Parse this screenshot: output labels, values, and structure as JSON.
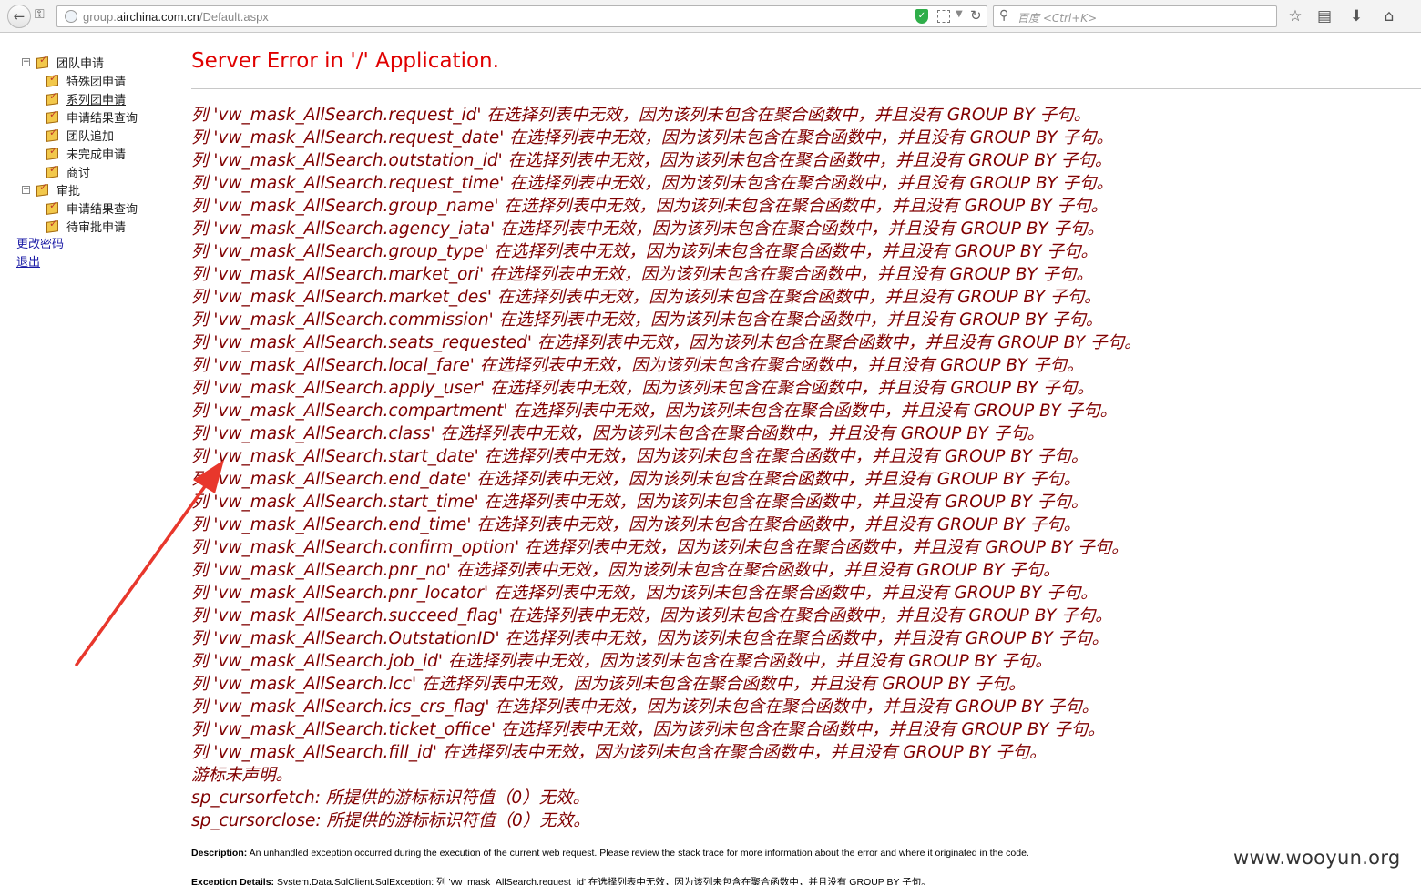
{
  "browser": {
    "url_prefix": "group.",
    "url_host": "airchina.com.cn",
    "url_path": "/Default.aspx",
    "search_placeholder": "百度 <Ctrl+K>"
  },
  "sidebar": {
    "groups": [
      {
        "label": "团队申请",
        "expander": "−",
        "items": [
          "特殊团申请",
          "系列团申请",
          "申请结果查询",
          "团队追加",
          "未完成申请",
          "商讨"
        ]
      },
      {
        "label": "审批",
        "expander": "−",
        "items": [
          "申请结果查询",
          "待审批申请"
        ]
      }
    ],
    "links": [
      "更改密码",
      "退出"
    ]
  },
  "error": {
    "title": "Server Error in '/' Application.",
    "lines": [
      "列 'vw_mask_AllSearch.request_id' 在选择列表中无效，因为该列未包含在聚合函数中，并且没有 GROUP BY 子句。",
      "列 'vw_mask_AllSearch.request_date' 在选择列表中无效，因为该列未包含在聚合函数中，并且没有 GROUP BY 子句。",
      "列 'vw_mask_AllSearch.outstation_id' 在选择列表中无效，因为该列未包含在聚合函数中，并且没有 GROUP BY 子句。",
      "列 'vw_mask_AllSearch.request_time' 在选择列表中无效，因为该列未包含在聚合函数中，并且没有 GROUP BY 子句。",
      "列 'vw_mask_AllSearch.group_name' 在选择列表中无效，因为该列未包含在聚合函数中，并且没有 GROUP BY 子句。",
      "列 'vw_mask_AllSearch.agency_iata' 在选择列表中无效，因为该列未包含在聚合函数中，并且没有 GROUP BY 子句。",
      "列 'vw_mask_AllSearch.group_type' 在选择列表中无效，因为该列未包含在聚合函数中，并且没有 GROUP BY 子句。",
      "列 'vw_mask_AllSearch.market_ori' 在选择列表中无效，因为该列未包含在聚合函数中，并且没有 GROUP BY 子句。",
      "列 'vw_mask_AllSearch.market_des' 在选择列表中无效，因为该列未包含在聚合函数中，并且没有 GROUP BY 子句。",
      "列 'vw_mask_AllSearch.commission' 在选择列表中无效，因为该列未包含在聚合函数中，并且没有 GROUP BY 子句。",
      "列 'vw_mask_AllSearch.seats_requested' 在选择列表中无效，因为该列未包含在聚合函数中，并且没有 GROUP BY 子句。",
      "列 'vw_mask_AllSearch.local_fare' 在选择列表中无效，因为该列未包含在聚合函数中，并且没有 GROUP BY 子句。",
      "列 'vw_mask_AllSearch.apply_user' 在选择列表中无效，因为该列未包含在聚合函数中，并且没有 GROUP BY 子句。",
      "列 'vw_mask_AllSearch.compartment' 在选择列表中无效，因为该列未包含在聚合函数中，并且没有 GROUP BY 子句。",
      "列 'vw_mask_AllSearch.class' 在选择列表中无效，因为该列未包含在聚合函数中，并且没有 GROUP BY 子句。",
      "列 'vw_mask_AllSearch.start_date' 在选择列表中无效，因为该列未包含在聚合函数中，并且没有 GROUP BY 子句。",
      "列 'vw_mask_AllSearch.end_date' 在选择列表中无效，因为该列未包含在聚合函数中，并且没有 GROUP BY 子句。",
      "列 'vw_mask_AllSearch.start_time' 在选择列表中无效，因为该列未包含在聚合函数中，并且没有 GROUP BY 子句。",
      "列 'vw_mask_AllSearch.end_time' 在选择列表中无效，因为该列未包含在聚合函数中，并且没有 GROUP BY 子句。",
      "列 'vw_mask_AllSearch.confirm_option' 在选择列表中无效，因为该列未包含在聚合函数中，并且没有 GROUP BY 子句。",
      "列 'vw_mask_AllSearch.pnr_no' 在选择列表中无效，因为该列未包含在聚合函数中，并且没有 GROUP BY 子句。",
      "列 'vw_mask_AllSearch.pnr_locator' 在选择列表中无效，因为该列未包含在聚合函数中，并且没有 GROUP BY 子句。",
      "列 'vw_mask_AllSearch.succeed_flag' 在选择列表中无效，因为该列未包含在聚合函数中，并且没有 GROUP BY 子句。",
      "列 'vw_mask_AllSearch.OutstationID' 在选择列表中无效，因为该列未包含在聚合函数中，并且没有 GROUP BY 子句。",
      "列 'vw_mask_AllSearch.job_id' 在选择列表中无效，因为该列未包含在聚合函数中，并且没有 GROUP BY 子句。",
      "列 'vw_mask_AllSearch.lcc' 在选择列表中无效，因为该列未包含在聚合函数中，并且没有 GROUP BY 子句。",
      "列 'vw_mask_AllSearch.ics_crs_flag' 在选择列表中无效，因为该列未包含在聚合函数中，并且没有 GROUP BY 子句。",
      "列 'vw_mask_AllSearch.ticket_office' 在选择列表中无效，因为该列未包含在聚合函数中，并且没有 GROUP BY 子句。",
      "列 'vw_mask_AllSearch.fill_id' 在选择列表中无效，因为该列未包含在聚合函数中，并且没有 GROUP BY 子句。",
      "游标未声明。",
      "sp_cursorfetch: 所提供的游标标识符值（0）无效。",
      "sp_cursorclose: 所提供的游标标识符值（0）无效。"
    ],
    "description_label": "Description:",
    "description_text": " An unhandled exception occurred during the execution of the current web request. Please review the stack trace for more information about the error and where it originated in the code.",
    "exception_label": "Exception Details:",
    "exception_text": " System.Data.SqlClient.SqlException: 列 'vw_mask_AllSearch.request_id' 在选择列表中无效，因为该列未包含在聚合函数中，并且没有 GROUP BY 子句。"
  },
  "watermark": "www.wooyun.org",
  "colors": {
    "title": "#e00000",
    "error_text": "#800000",
    "link": "#1a1aa6",
    "arrow": "#e8372c"
  }
}
